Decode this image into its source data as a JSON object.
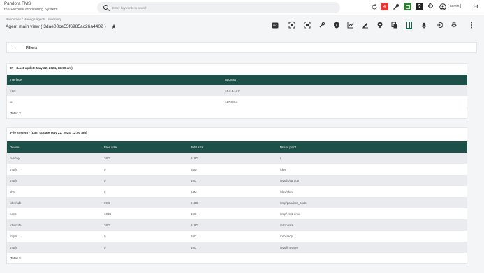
{
  "brand": {
    "name": "Pandora FMS",
    "tagline": "the Flexible Monitoring System"
  },
  "search": {
    "placeholder": "Enter keywords to search"
  },
  "header": {
    "notification_count": "4",
    "user": "[ admin ]"
  },
  "breadcrumb": "Resources / Manage agents / Inventory",
  "page": {
    "title": "Agent main view ( 3dae00ce55f6985ac26a4402 )"
  },
  "filters": {
    "label": "Filters"
  },
  "ip_section": {
    "title": "IP - (Last update May 22, 2024, 12:00 am)",
    "headers": [
      "Interface",
      "Address"
    ],
    "rows": [
      [
        "eth0",
        "10.0.0.137"
      ],
      [
        "lo",
        "127.0.0.1"
      ]
    ],
    "total": "Total: 2"
  },
  "fs_section": {
    "title": "File system - (Last update May 22, 2024, 12:00 am)",
    "headers": [
      "Device",
      "Free size",
      "Total size",
      "Mount point"
    ],
    "rows": [
      [
        "overlay",
        "38G",
        "919G",
        "/"
      ],
      [
        "tmpfs",
        "0",
        "64M",
        "/dev"
      ],
      [
        "tmpfs",
        "0",
        "16G",
        "/sys/fs/cgroup"
      ],
      [
        "shm",
        "0",
        "64M",
        "/dev/shm"
      ],
      [
        "/dev/sdc",
        "39G",
        "918G",
        "/tmp/pandora_code"
      ],
      [
        "none",
        "100K",
        "16G",
        "/tmp/.X11-unix"
      ],
      [
        "/dev/sde",
        "38G",
        "919G",
        "/etc/hosts"
      ],
      [
        "tmpfs",
        "0",
        "16G",
        "/proc/acpi"
      ],
      [
        "tmpfs",
        "0",
        "16G",
        "/sys/firmware"
      ]
    ],
    "total": "Total: 9"
  },
  "colors": {
    "table_header": "#1d5048",
    "row_alt": "#e9ebee",
    "badge_red": "#e53935",
    "active_tool": "#1d5e4f"
  }
}
